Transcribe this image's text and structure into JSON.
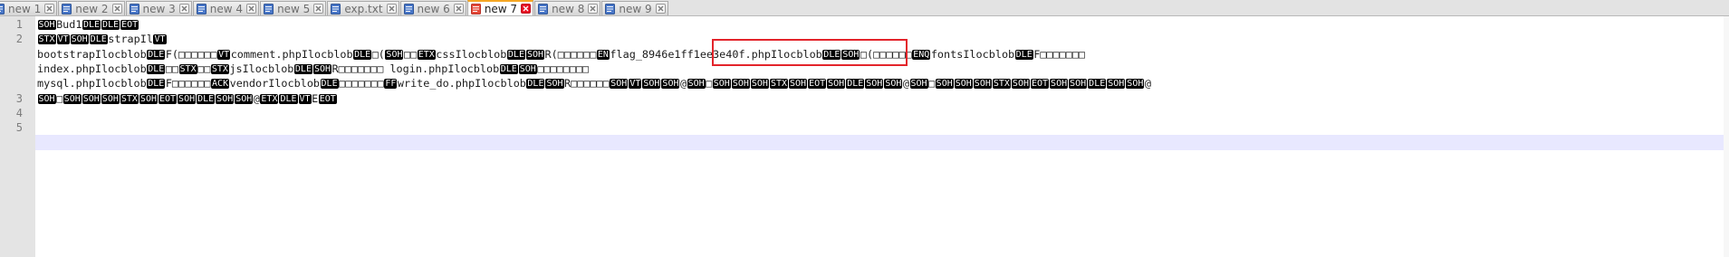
{
  "tabs": [
    {
      "label": "new 1",
      "active": false
    },
    {
      "label": "new 2",
      "active": false
    },
    {
      "label": "new 3",
      "active": false
    },
    {
      "label": "new 4",
      "active": false
    },
    {
      "label": "new 5",
      "active": false
    },
    {
      "label": "exp.txt",
      "active": false
    },
    {
      "label": "new 6",
      "active": false
    },
    {
      "label": "new 7",
      "active": true
    },
    {
      "label": "new 8",
      "active": false
    },
    {
      "label": "new 9",
      "active": false
    }
  ],
  "line_numbers": [
    "1",
    "2",
    "",
    "",
    "",
    "3",
    "4",
    "5"
  ],
  "lines": [
    [
      {
        "c": "SOH"
      },
      {
        "t": "Bud1"
      },
      {
        "c": "DLE"
      },
      {
        "c": "DLE"
      },
      {
        "c": "EOT"
      }
    ],
    [
      {
        "c": "STX"
      },
      {
        "c": "VT"
      },
      {
        "c": "SOH"
      },
      {
        "c": "DLE"
      },
      {
        "t": "strapIl"
      },
      {
        "c": "VT"
      }
    ],
    [
      {
        "t": "bootstrapIlocblob"
      },
      {
        "c": "DLE"
      },
      {
        "t": "F(□□□□□□"
      },
      {
        "c": "VT"
      },
      {
        "t": "comment.phpIlocblob"
      },
      {
        "c": "DLE"
      },
      {
        "t": "□("
      },
      {
        "c": "SOH"
      },
      {
        "t": "□□"
      },
      {
        "c": "ETX"
      },
      {
        "t": "cssIlocblob"
      },
      {
        "c": "DLE"
      },
      {
        "c": "SOH"
      },
      {
        "t": "R(□□□□□□"
      },
      {
        "c": "EN"
      },
      {
        "t": "flag_8946e1ff1ee3e40f.php"
      },
      {
        "t": "Ilocblob"
      },
      {
        "c": "DLE"
      },
      {
        "c": "SOH"
      },
      {
        "t": "□(□□□□□□"
      },
      {
        "c": "ENQ"
      },
      {
        "t": "fontsIlocblob"
      },
      {
        "c": "DLE"
      },
      {
        "t": "F□□□□□□□"
      }
    ],
    [
      {
        "t": "index.phpIlocblob"
      },
      {
        "c": "DLE"
      },
      {
        "t": "□□"
      },
      {
        "c": "STX"
      },
      {
        "t": "□□"
      },
      {
        "c": "STX"
      },
      {
        "t": "jsIlocblob"
      },
      {
        "c": "DLE"
      },
      {
        "c": "SOH"
      },
      {
        "t": "R□□□□□□□ login.phpIlocblob"
      },
      {
        "c": "DLE"
      },
      {
        "c": "SOH"
      },
      {
        "t": "□□□□□□□□"
      }
    ],
    [
      {
        "t": "mysql.phpIlocblob"
      },
      {
        "c": "DLE"
      },
      {
        "t": "F□□□□□□"
      },
      {
        "c": "ACK"
      },
      {
        "t": "vendorIlocblob"
      },
      {
        "c": "DLE"
      },
      {
        "t": "□□□□□□□"
      },
      {
        "c": "FF"
      },
      {
        "t": "write_do.phpIlocblob"
      },
      {
        "c": "DLE"
      },
      {
        "c": "SOH"
      },
      {
        "t": "R□□□□□□"
      },
      {
        "c": "SOH"
      },
      {
        "c": "VT"
      },
      {
        "c": "SOH"
      },
      {
        "c": "SOH"
      },
      {
        "t": "@"
      },
      {
        "c": "SOH"
      },
      {
        "t": "□"
      },
      {
        "c": "SOH"
      },
      {
        "c": "SOH"
      },
      {
        "c": "SOH"
      },
      {
        "c": "STX"
      },
      {
        "c": "SOH"
      },
      {
        "c": "EOT"
      },
      {
        "c": "SOH"
      },
      {
        "c": "DLE"
      },
      {
        "c": "SOH"
      },
      {
        "c": "SOH"
      },
      {
        "t": "@"
      },
      {
        "c": "SOH"
      },
      {
        "t": "□"
      },
      {
        "c": "SOH"
      },
      {
        "c": "SOH"
      },
      {
        "c": "SOH"
      },
      {
        "c": "STX"
      },
      {
        "c": "SOH"
      },
      {
        "c": "EOT"
      },
      {
        "c": "SOH"
      },
      {
        "c": "SOH"
      },
      {
        "c": "DLE"
      },
      {
        "c": "SOH"
      },
      {
        "c": "SOH"
      },
      {
        "t": "@"
      }
    ],
    [
      {
        "c": "SOH"
      },
      {
        "t": "□"
      },
      {
        "c": "SOH"
      },
      {
        "c": "SOH"
      },
      {
        "c": "SOH"
      },
      {
        "c": "STX"
      },
      {
        "c": "SOH"
      },
      {
        "c": "EOT"
      },
      {
        "c": "SOH"
      },
      {
        "c": "DLE"
      },
      {
        "c": "SOH"
      },
      {
        "c": "SOH"
      },
      {
        "t": "@"
      },
      {
        "c": "ETX"
      },
      {
        "c": "DLE"
      },
      {
        "c": "VT"
      },
      {
        "t": "E"
      },
      {
        "c": "EOT"
      }
    ],
    [],
    [],
    []
  ],
  "colors": {
    "highlight_box": "#e3242b",
    "control_char_bg": "#000000",
    "control_char_fg": "#ffffff",
    "current_line": "#e8e8ff",
    "active_tab_accent": "#f5a623",
    "close_active": "#e81123"
  },
  "icons": {
    "tab_file": "notepad-file-icon",
    "tab_active_file": "unsaved-file-icon",
    "tab_close": "close-icon"
  }
}
